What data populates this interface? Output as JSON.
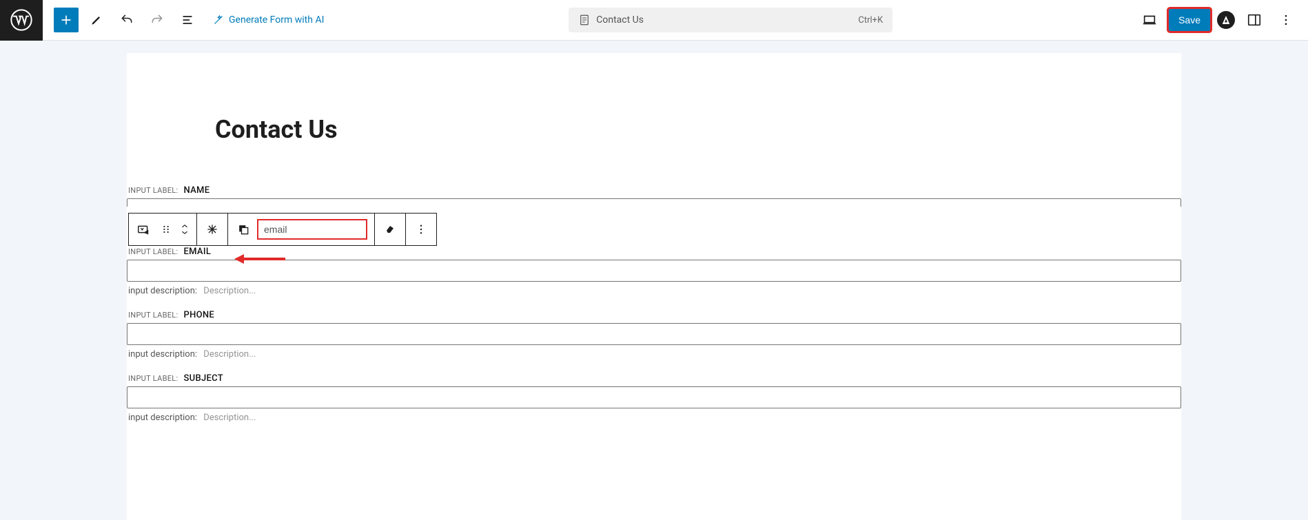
{
  "header": {
    "ai_link_label": "Generate Form with AI",
    "doc_title": "Contact Us",
    "shortcut": "Ctrl+K",
    "save_label": "Save"
  },
  "page": {
    "title": "Contact Us"
  },
  "labels": {
    "input_label_prefix": "INPUT LABEL:",
    "input_desc_prefix": "input description:",
    "desc_placeholder": "Description..."
  },
  "fields": [
    {
      "label": "NAME"
    },
    {
      "label": "EMAIL"
    },
    {
      "label": "PHONE"
    },
    {
      "label": "SUBJECT"
    }
  ],
  "block_toolbar": {
    "type_value": "email"
  },
  "icons": {
    "add": "plus-icon",
    "edit": "pencil-icon",
    "undo": "undo-icon",
    "redo": "redo-icon",
    "outline": "list-view-icon",
    "wand": "magic-wand-icon",
    "page": "page-icon",
    "device": "desktop-icon",
    "astra": "astra-icon",
    "panel": "panel-icon",
    "more": "more-vertical-icon"
  }
}
